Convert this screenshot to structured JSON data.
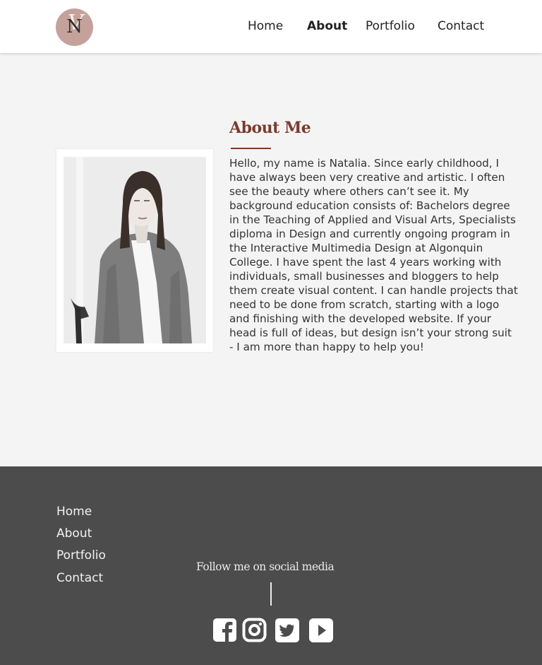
{
  "brand": {
    "logo_letter": "N",
    "logo_overlay": "V"
  },
  "nav": {
    "items": [
      {
        "label": "Home"
      },
      {
        "label": "About"
      },
      {
        "label": "Portfolio"
      },
      {
        "label": "Contact"
      }
    ],
    "active": "About"
  },
  "about": {
    "title": "About Me",
    "bio": "Hello, my name is Natalia. Since early childhood, I have always been very creative and artistic. I often see the beauty where others can’t see it.  My background education consists of: Bachelors degree in the Teaching of Applied and Visual Arts, Specialists diploma in Design and currently ongoing program in the Interactive Multimedia Design at Algonquin College. I have spent the last 4 years working with individuals, small businesses and bloggers to help them create visual content. I can handle projects that need to be done from scratch, starting with a logo and finishing with the developed website. If your head is full of ideas, but design isn’t your strong suit - I am more than happy to help you!"
  },
  "footer": {
    "links": [
      {
        "label": "Home"
      },
      {
        "label": "About"
      },
      {
        "label": "Portfolio"
      },
      {
        "label": "Contact"
      }
    ],
    "follow_text": "Follow me on social media",
    "social": [
      "facebook-icon",
      "instagram-icon",
      "twitter-icon",
      "youtube-icon"
    ]
  },
  "colors": {
    "accent": "#7a3b2e",
    "logo_bg": "#c4a29b",
    "footer_bg": "#4c4c4c",
    "page_bg": "#f4f4f4"
  }
}
